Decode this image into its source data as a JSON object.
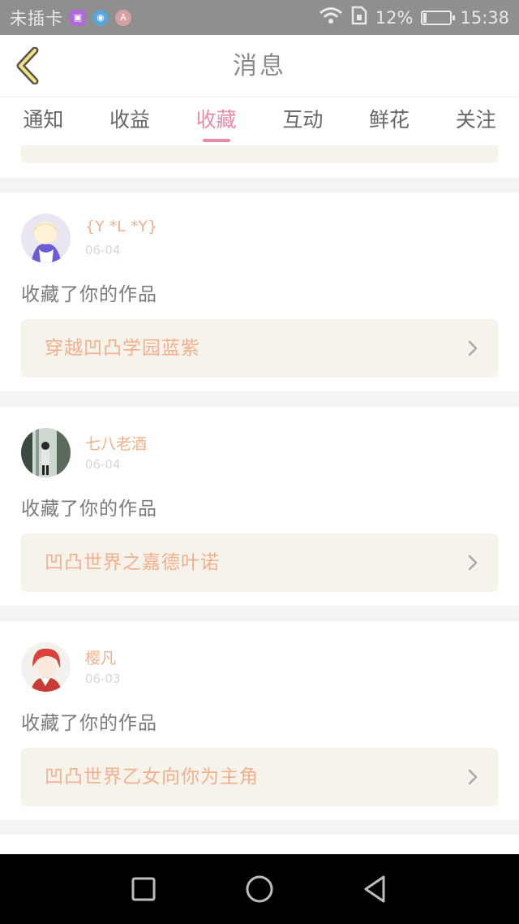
{
  "status_bar": {
    "carrier": "未插卡",
    "battery_percent": "12%",
    "battery_level": 0.12,
    "time": "15:38",
    "icons": [
      "gallery-icon",
      "sync-icon",
      "app-icon",
      "wifi-icon",
      "sim-icon",
      "battery-charging-icon"
    ]
  },
  "header": {
    "back_icon": "chevron-left-icon",
    "title": "消息"
  },
  "tabs": [
    {
      "label": "通知",
      "active": false
    },
    {
      "label": "收益",
      "active": false
    },
    {
      "label": "收藏",
      "active": true
    },
    {
      "label": "互动",
      "active": false
    },
    {
      "label": "鲜花",
      "active": false
    },
    {
      "label": "关注",
      "active": false
    }
  ],
  "messages": [
    {
      "username": "{Y *L *Y}",
      "date": "06-04",
      "action": "收藏了你的作品",
      "work_title": "穿越凹凸学园蓝紫"
    },
    {
      "username": "七八老酒",
      "date": "06-04",
      "action": "收藏了你的作品",
      "work_title": "凹凸世界之嘉德叶诺"
    },
    {
      "username": "樱凡",
      "date": "06-03",
      "action": "收藏了你的作品",
      "work_title": "凹凸世界乙女向你为主角"
    }
  ],
  "colors": {
    "accent": "#e88aa9",
    "username": "#f2b08c",
    "link_bg": "#f5f3ec",
    "page_bg": "#f4f4f4"
  },
  "nav_bar": [
    "recent-apps-icon",
    "home-icon",
    "back-triangle-icon"
  ]
}
